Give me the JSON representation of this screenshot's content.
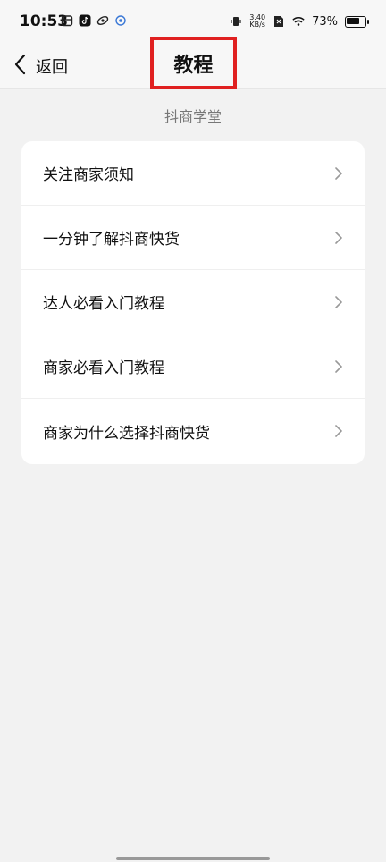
{
  "status": {
    "time": "10:53",
    "net_speed_top": "3.40",
    "net_speed_bottom": "KB/s",
    "battery_text": "73%",
    "battery_level": 0.73
  },
  "nav": {
    "back_label": "返回",
    "title": "教程"
  },
  "section": {
    "title": "抖商学堂"
  },
  "list": [
    {
      "label": "关注商家须知"
    },
    {
      "label": "一分钟了解抖商快货"
    },
    {
      "label": "达人必看入门教程"
    },
    {
      "label": "商家必看入门教程"
    },
    {
      "label": "商家为什么选择抖商快货"
    }
  ],
  "colors": {
    "highlight": "#e02020",
    "background": "#f2f2f2"
  }
}
